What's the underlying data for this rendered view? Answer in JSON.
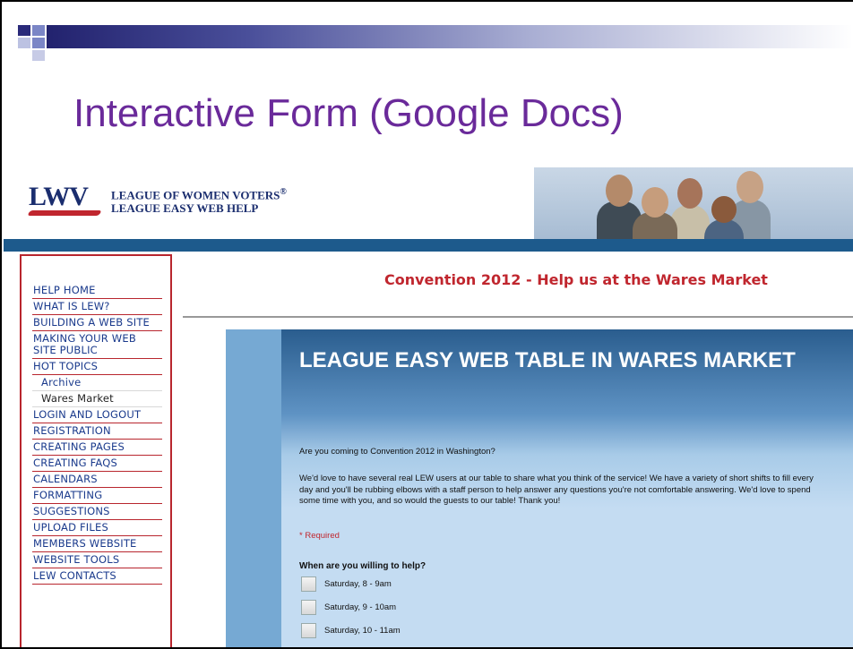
{
  "slide": {
    "title": "Interactive Form (Google Docs)"
  },
  "header": {
    "logo_mark": "LWV",
    "org_name": "LEAGUE OF WOMEN VOTERS",
    "registered_mark": "®",
    "subtitle": "LEAGUE EASY WEB HELP"
  },
  "sidebar": {
    "items": [
      {
        "label": "HELP HOME"
      },
      {
        "label": "WHAT IS LEW?"
      },
      {
        "label": "BUILDING A WEB SITE"
      },
      {
        "label": "MAKING YOUR WEB SITE PUBLIC"
      },
      {
        "label": "HOT TOPICS"
      },
      {
        "label": "Archive"
      },
      {
        "label": "Wares Market"
      },
      {
        "label": "LOGIN AND LOGOUT"
      },
      {
        "label": "REGISTRATION"
      },
      {
        "label": "CREATING PAGES"
      },
      {
        "label": "CREATING FAQS"
      },
      {
        "label": "CALENDARS"
      },
      {
        "label": "FORMATTING"
      },
      {
        "label": "SUGGESTIONS"
      },
      {
        "label": "UPLOAD FILES"
      },
      {
        "label": "MEMBERS WEBSITE"
      },
      {
        "label": "WEBSITE TOOLS"
      },
      {
        "label": "LEW CONTACTS"
      }
    ]
  },
  "main": {
    "heading": "Convention 2012 - Help us at the Wares Market"
  },
  "form": {
    "title": "LEAGUE EASY WEB TABLE IN WARES MARKET",
    "intro": "Are you coming to Convention 2012 in Washington?",
    "description": "We'd love to have several real LEW users at our table to share what you think of the service! We have a variety of short shifts to fill every day and you'll be rubbing elbows with a staff person to help answer any questions you're not comfortable answering. We'd love to spend some time with you, and so would the guests to our table!  Thank you!",
    "required_note": "* Required",
    "question": "When are you willing to help?",
    "options": [
      {
        "label": "Saturday, 8 - 9am",
        "checked": false
      },
      {
        "label": "Saturday, 9 - 10am",
        "checked": false
      },
      {
        "label": "Saturday, 10 - 11am",
        "checked": false
      }
    ]
  },
  "colors": {
    "slide_title": "#6a2a9a",
    "heading_red": "#c0262e",
    "nav_link": "#1a3a8c",
    "band_blue": "#1d5a8c"
  }
}
